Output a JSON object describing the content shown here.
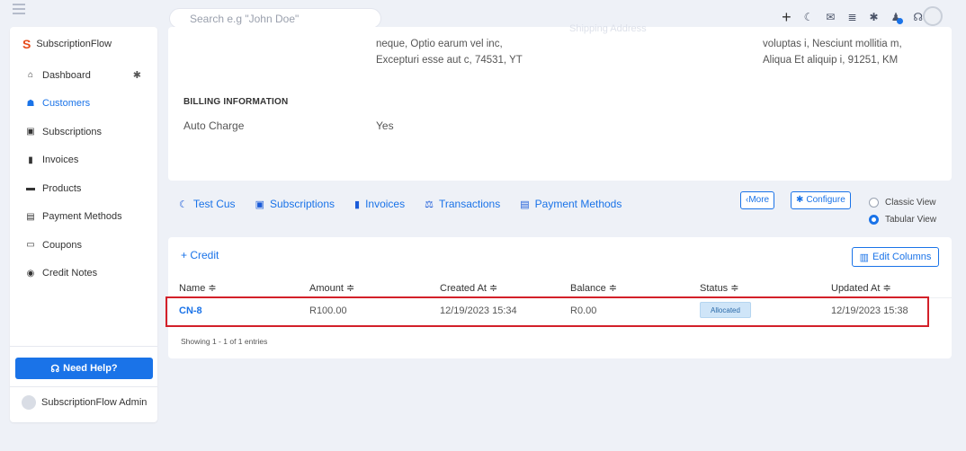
{
  "topbar": {
    "search_placeholder": "Search e.g \"John Doe\"",
    "icons": [
      "plus-icon",
      "moon-icon",
      "mail-icon",
      "stack-icon",
      "gear-icon",
      "bell-icon",
      "headset-icon",
      "user-avatar"
    ]
  },
  "sidebar": {
    "brand": "SubscriptionFlow",
    "items": [
      {
        "label": "Dashboard",
        "icon": "home-icon"
      },
      {
        "label": "Customers",
        "icon": "users-icon",
        "active": true
      },
      {
        "label": "Subscriptions",
        "icon": "calendar-check-icon"
      },
      {
        "label": "Invoices",
        "icon": "file-invoice-icon"
      },
      {
        "label": "Products",
        "icon": "archive-icon"
      },
      {
        "label": "Payment Methods",
        "icon": "credit-card-icon"
      },
      {
        "label": "Coupons",
        "icon": "ticket-icon"
      },
      {
        "label": "Credit Notes",
        "icon": "credit-note-icon"
      }
    ],
    "help_label": "Need Help?",
    "admin_name": "SubscriptionFlow Admin"
  },
  "details": {
    "address_left": [
      "neque, Optio earum vel inc,",
      "Excepturi esse aut c, 74531, YT"
    ],
    "address_right": [
      "voluptas i, Nesciunt mollitia m,",
      "Aliqua Et aliquip i, 91251, KM"
    ],
    "ghost_left": "Shipping Address",
    "billing_title": "BILLING INFORMATION",
    "auto_charge_label": "Auto Charge",
    "auto_charge_value": "Yes"
  },
  "tabs": [
    {
      "label": "Test Cus",
      "icon": "customer-icon"
    },
    {
      "label": "Subscriptions",
      "icon": "calendar-check-icon"
    },
    {
      "label": "Invoices",
      "icon": "file-invoice-icon"
    },
    {
      "label": "Transactions",
      "icon": "hand-coin-icon"
    },
    {
      "label": "Payment Methods",
      "icon": "credit-card-icon"
    }
  ],
  "actions": {
    "more_label": "‹More",
    "configure_label": "Configure",
    "view_classic": "Classic View",
    "view_tabular": "Tabular View",
    "selected_view": "Tabular View"
  },
  "credit_notes": {
    "add_label": "+ Credit",
    "edit_columns_label": "Edit Columns",
    "columns": [
      "Name ≑",
      "Amount ≑",
      "Created At ≑",
      "Balance ≑",
      "Status ≑",
      "Updated At ≑"
    ],
    "rows": [
      {
        "name": "CN-8",
        "amount": "R100.00",
        "created_at": "12/19/2023 15:34",
        "balance": "R0.00",
        "status": "Allocated",
        "updated_at": "12/19/2023 15:38"
      }
    ],
    "showing": "Showing 1 - 1 of 1 entries"
  },
  "colors": {
    "accent": "#1a73e8",
    "highlight": "#d32029",
    "badge_bg": "#cfe5f8"
  }
}
